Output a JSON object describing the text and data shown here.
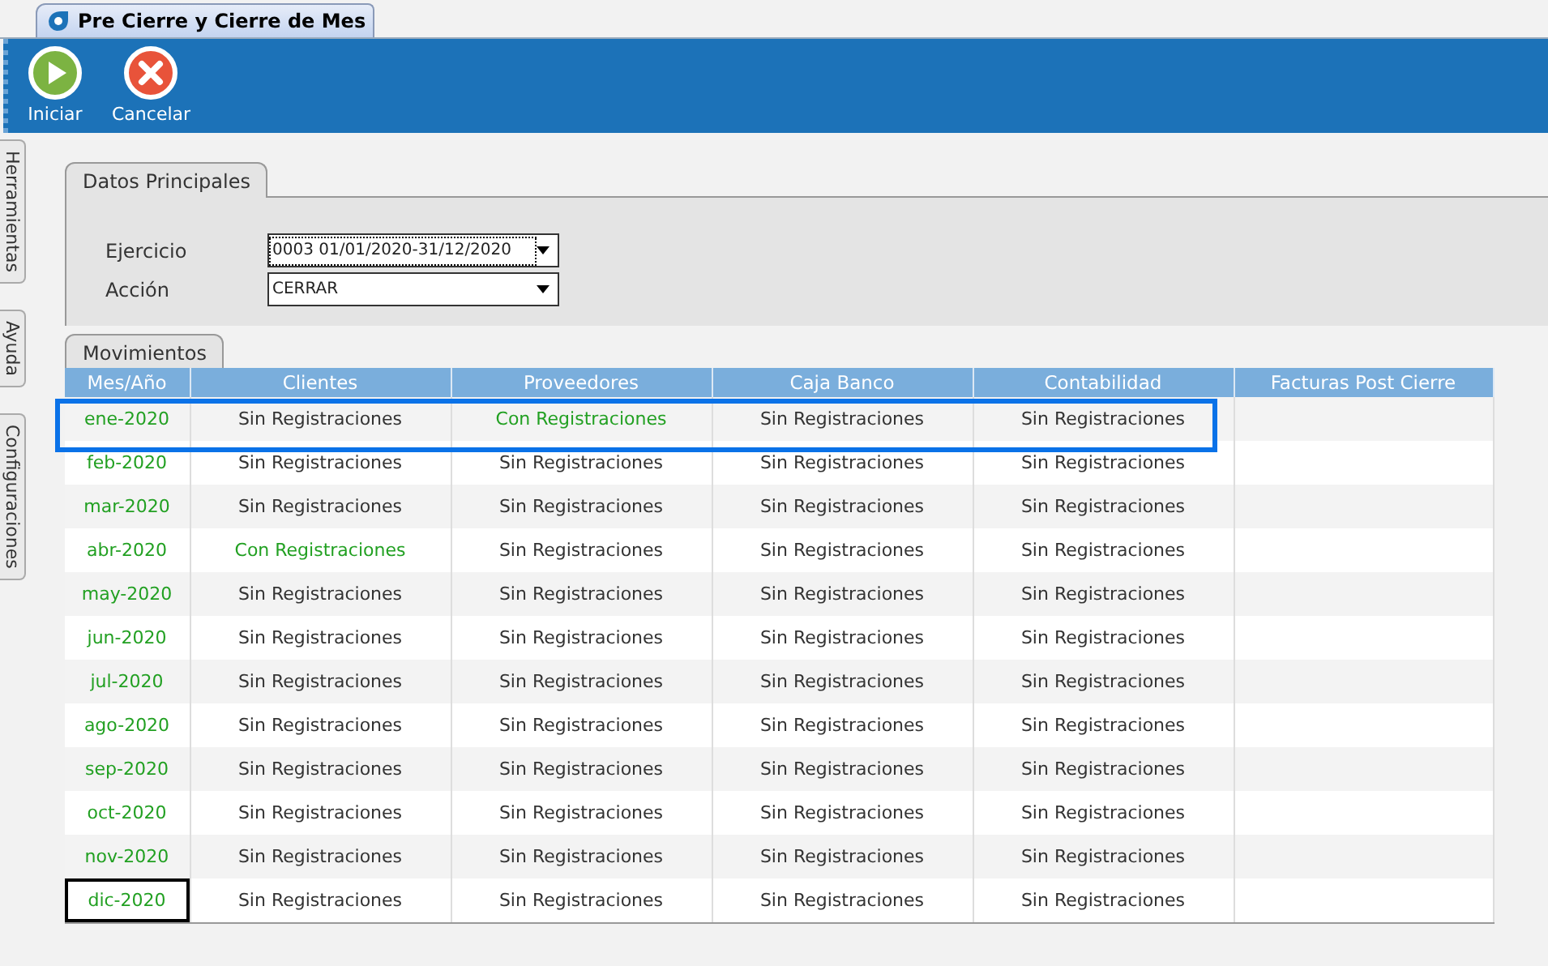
{
  "window": {
    "title": "Pre Cierre y Cierre de Mes"
  },
  "toolbar": [
    {
      "kind": "start",
      "label": "Iniciar"
    },
    {
      "kind": "cancel",
      "label": "Cancelar"
    }
  ],
  "side_tabs": [
    "Herramientas",
    "Ayuda",
    "Configuraciones"
  ],
  "main_data": {
    "title": "Datos Principales",
    "fields": [
      {
        "label": "Ejercicio",
        "value": "0003 01/01/2020-31/12/2020",
        "focused": true
      },
      {
        "label": "Acción",
        "value": "CERRAR",
        "focused": false
      }
    ]
  },
  "movements": {
    "title": "Movimientos",
    "columns": [
      "Mes/Año",
      "Clientes",
      "Proveedores",
      "Caja Banco",
      "Contabilidad",
      "Facturas Post Cierre"
    ],
    "rows": [
      {
        "highlighted": true,
        "cells": [
          {
            "text": "ene-2020",
            "focused": false
          },
          {
            "text": "Sin Registraciones",
            "with_records": false
          },
          {
            "text": "Con Registraciones",
            "with_records": true
          },
          {
            "text": "Sin Registraciones",
            "with_records": false
          },
          {
            "text": "Sin Registraciones",
            "with_records": false
          }
        ]
      },
      {
        "highlighted": false,
        "cells": [
          {
            "text": "feb-2020",
            "focused": false
          },
          {
            "text": "Sin Registraciones",
            "with_records": false
          },
          {
            "text": "Sin Registraciones",
            "with_records": false
          },
          {
            "text": "Sin Registraciones",
            "with_records": false
          },
          {
            "text": "Sin Registraciones",
            "with_records": false
          }
        ]
      },
      {
        "highlighted": false,
        "cells": [
          {
            "text": "mar-2020",
            "focused": false
          },
          {
            "text": "Sin Registraciones",
            "with_records": false
          },
          {
            "text": "Sin Registraciones",
            "with_records": false
          },
          {
            "text": "Sin Registraciones",
            "with_records": false
          },
          {
            "text": "Sin Registraciones",
            "with_records": false
          }
        ]
      },
      {
        "highlighted": false,
        "cells": [
          {
            "text": "abr-2020",
            "focused": false
          },
          {
            "text": "Con Registraciones",
            "with_records": true
          },
          {
            "text": "Sin Registraciones",
            "with_records": false
          },
          {
            "text": "Sin Registraciones",
            "with_records": false
          },
          {
            "text": "Sin Registraciones",
            "with_records": false
          }
        ]
      },
      {
        "highlighted": false,
        "cells": [
          {
            "text": "may-2020",
            "focused": false
          },
          {
            "text": "Sin Registraciones",
            "with_records": false
          },
          {
            "text": "Sin Registraciones",
            "with_records": false
          },
          {
            "text": "Sin Registraciones",
            "with_records": false
          },
          {
            "text": "Sin Registraciones",
            "with_records": false
          }
        ]
      },
      {
        "highlighted": false,
        "cells": [
          {
            "text": "jun-2020",
            "focused": false
          },
          {
            "text": "Sin Registraciones",
            "with_records": false
          },
          {
            "text": "Sin Registraciones",
            "with_records": false
          },
          {
            "text": "Sin Registraciones",
            "with_records": false
          },
          {
            "text": "Sin Registraciones",
            "with_records": false
          }
        ]
      },
      {
        "highlighted": false,
        "cells": [
          {
            "text": "jul-2020",
            "focused": false
          },
          {
            "text": "Sin Registraciones",
            "with_records": false
          },
          {
            "text": "Sin Registraciones",
            "with_records": false
          },
          {
            "text": "Sin Registraciones",
            "with_records": false
          },
          {
            "text": "Sin Registraciones",
            "with_records": false
          }
        ]
      },
      {
        "highlighted": false,
        "cells": [
          {
            "text": "ago-2020",
            "focused": false
          },
          {
            "text": "Sin Registraciones",
            "with_records": false
          },
          {
            "text": "Sin Registraciones",
            "with_records": false
          },
          {
            "text": "Sin Registraciones",
            "with_records": false
          },
          {
            "text": "Sin Registraciones",
            "with_records": false
          }
        ]
      },
      {
        "highlighted": false,
        "cells": [
          {
            "text": "sep-2020",
            "focused": false
          },
          {
            "text": "Sin Registraciones",
            "with_records": false
          },
          {
            "text": "Sin Registraciones",
            "with_records": false
          },
          {
            "text": "Sin Registraciones",
            "with_records": false
          },
          {
            "text": "Sin Registraciones",
            "with_records": false
          }
        ]
      },
      {
        "highlighted": false,
        "cells": [
          {
            "text": "oct-2020",
            "focused": false
          },
          {
            "text": "Sin Registraciones",
            "with_records": false
          },
          {
            "text": "Sin Registraciones",
            "with_records": false
          },
          {
            "text": "Sin Registraciones",
            "with_records": false
          },
          {
            "text": "Sin Registraciones",
            "with_records": false
          }
        ]
      },
      {
        "highlighted": false,
        "cells": [
          {
            "text": "nov-2020",
            "focused": false
          },
          {
            "text": "Sin Registraciones",
            "with_records": false
          },
          {
            "text": "Sin Registraciones",
            "with_records": false
          },
          {
            "text": "Sin Registraciones",
            "with_records": false
          },
          {
            "text": "Sin Registraciones",
            "with_records": false
          }
        ]
      },
      {
        "highlighted": false,
        "cells": [
          {
            "text": "dic-2020",
            "focused": true
          },
          {
            "text": "Sin Registraciones",
            "with_records": false
          },
          {
            "text": "Sin Registraciones",
            "with_records": false
          },
          {
            "text": "Sin Registraciones",
            "with_records": false
          },
          {
            "text": "Sin Registraciones",
            "with_records": false
          }
        ]
      }
    ]
  }
}
